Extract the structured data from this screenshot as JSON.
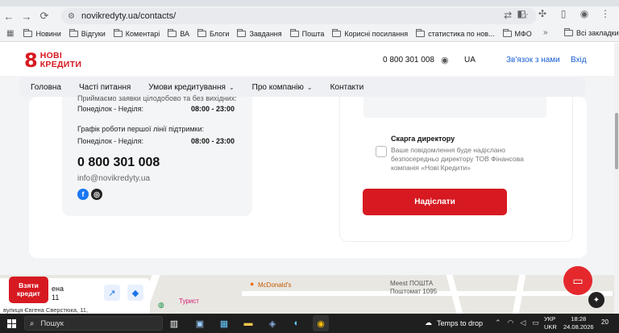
{
  "browser": {
    "url": "novikredyty.ua/contacts/",
    "bookmarks": [
      {
        "label": "Новини"
      },
      {
        "label": "Відгуки"
      },
      {
        "label": "Коментарі"
      },
      {
        "label": "ВА"
      },
      {
        "label": "Блоги"
      },
      {
        "label": "Завдання"
      },
      {
        "label": "Пошта"
      },
      {
        "label": "Корисні посилання"
      },
      {
        "label": "статистика по нов..."
      },
      {
        "label": "МФО"
      }
    ],
    "all_bookmarks": "Всі закладки"
  },
  "header": {
    "logo_line1": "НОВІ",
    "logo_line2": "КРЕДИТИ",
    "phone": "0 800 301 008",
    "lang": "UA",
    "contact_link": "Зв'язок з нами",
    "login_link": "Вхід"
  },
  "menu": {
    "items": [
      {
        "label": "Головна",
        "dropdown": false
      },
      {
        "label": "Часті питання",
        "dropdown": false
      },
      {
        "label": "Умови кредитування",
        "dropdown": true
      },
      {
        "label": "Про компанію",
        "dropdown": true
      },
      {
        "label": "Контакти",
        "dropdown": false
      }
    ]
  },
  "contacts": {
    "cut_line": "Приймаємо заявки цілодобово та без вихідних:",
    "row1_day": "Понеділок - Неділя:",
    "row1_time": "08:00 - 23:00",
    "support_title": "Графік роботи першої лінії підтримки:",
    "row2_day": "Понеділок - Неділя:",
    "row2_time": "08:00 - 23:00",
    "big_phone": "0 800 301 008",
    "email": "info@novikredyty.ua"
  },
  "form": {
    "checkbox_title": "Скарга директору",
    "checkbox_desc": "Ваше повідомлення буде надіслано безпосередньо директору ТОВ Фінансова компанія «Нові Кредити»",
    "submit": "Надіслати"
  },
  "map": {
    "card_line1": "ена",
    "card_line2": "11",
    "card_addr": "вулиця Євгена Сверстюка, 11,",
    "mcd": "McDonald's",
    "meest1": "Meest ПОШТА",
    "meest2": "Поштомат 1095",
    "turyst": "Турист"
  },
  "float": {
    "take_credit_1": "Взяти",
    "take_credit_2": "кредит"
  },
  "taskbar": {
    "search": "Пошук",
    "weather": "Temps to drop",
    "lang1": "УКР",
    "lang2": "UKR",
    "time": "18:28",
    "date": "24.08.2026",
    "notif": "20"
  }
}
